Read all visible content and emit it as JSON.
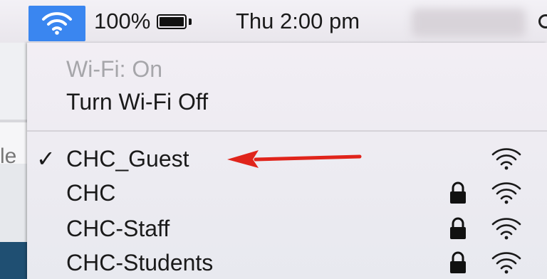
{
  "menubar": {
    "battery_percent": "100%",
    "battery_level": 1.0,
    "clock": "Thu 2:00 pm"
  },
  "background_window": {
    "partial_text": "le"
  },
  "wifi_menu": {
    "status": "Wi-Fi: On",
    "toggle_label": "Turn Wi-Fi Off",
    "networks": [
      {
        "name": "CHC_Guest",
        "connected": true,
        "locked": false,
        "icon": "wifi-signal-icon"
      },
      {
        "name": "CHC",
        "connected": false,
        "locked": true,
        "icon": "wifi-signal-icon"
      },
      {
        "name": "CHC-Staff",
        "connected": false,
        "locked": true,
        "icon": "wifi-signal-icon"
      },
      {
        "name": "CHC-Students",
        "connected": false,
        "locked": true,
        "icon": "wifi-signal-icon"
      }
    ],
    "checkmark": "✓"
  },
  "colors": {
    "accent": "#3a86f0",
    "annotation_arrow": "#e0241b",
    "menu_text": "#1a1a1a",
    "disabled_text": "#a6a6aa"
  }
}
